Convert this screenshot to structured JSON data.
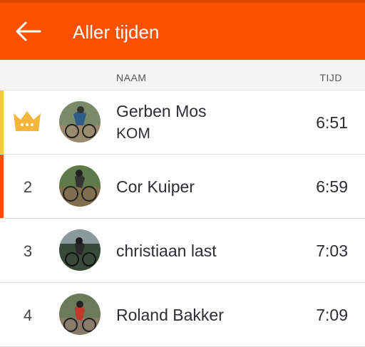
{
  "header": {
    "title": "Aller tijden",
    "back_icon": "arrow-left-icon"
  },
  "columns": {
    "name": "NAAM",
    "time": "TIJD"
  },
  "colors": {
    "brand": "#fc5200",
    "kom_accent": "#f5c842",
    "crown": "#f3b63a",
    "rank2_accent": "#fc5200"
  },
  "rows": [
    {
      "rank": "",
      "rank_icon": "crown-icon",
      "name": "Gerben Mos",
      "badge": "KOM",
      "time": "6:51"
    },
    {
      "rank": "2",
      "name": "Cor Kuiper",
      "time": "6:59"
    },
    {
      "rank": "3",
      "name": "christiaan last",
      "time": "7:03"
    },
    {
      "rank": "4",
      "name": "Roland Bakker",
      "time": "7:09"
    }
  ]
}
